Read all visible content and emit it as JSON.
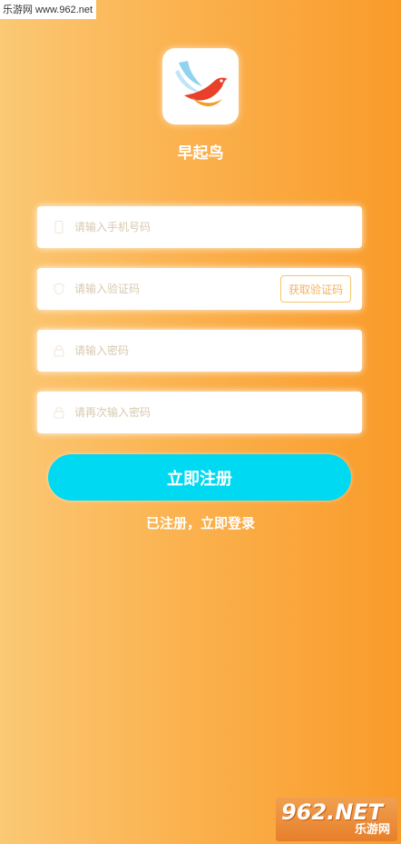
{
  "watermark": {
    "top_text": "乐游网 www.962.net",
    "bottom_number": "962.NET",
    "bottom_site": "乐游网"
  },
  "app": {
    "name": "早起鸟"
  },
  "form": {
    "phone_placeholder": "请输入手机号码",
    "code_placeholder": "请输入验证码",
    "get_code_label": "获取验证码",
    "password_placeholder": "请输入密码",
    "confirm_placeholder": "请再次输入密码"
  },
  "actions": {
    "register_label": "立即注册",
    "login_link": "已注册，立即登录"
  },
  "colors": {
    "accent": "#00d9f2",
    "background_start": "#fbc874",
    "background_end": "#f99b2a"
  },
  "icons": [
    "phone-icon",
    "shield-icon",
    "lock-icon",
    "lock-icon"
  ]
}
